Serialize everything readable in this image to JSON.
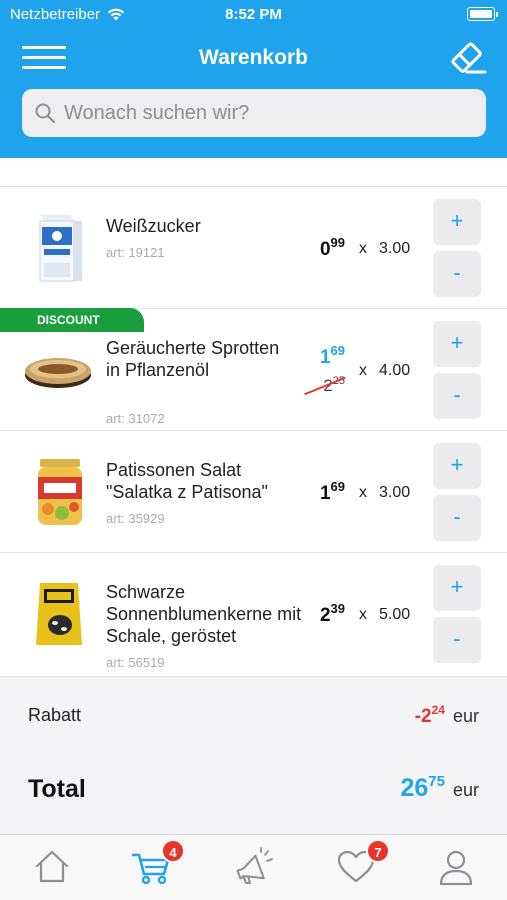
{
  "status": {
    "carrier": "Netzbetreiber",
    "time": "8:52 PM"
  },
  "header": {
    "title": "Warenkorb"
  },
  "search": {
    "placeholder": "Wonach suchen wir?"
  },
  "items": [
    {
      "name": "Weißzucker",
      "art": "art: 19121",
      "price_int": "0",
      "price_dec": "99",
      "qty_x": "x",
      "qty": "3.00",
      "plus": "+",
      "minus": "-"
    },
    {
      "badge": "DISCOUNT",
      "name": "Geräucherte Sprotten in Pflanzenöl",
      "art": "art: 31072",
      "price_int": "1",
      "price_dec": "69",
      "old_int": "2",
      "old_dec": "25",
      "qty_x": "x",
      "qty": "4.00",
      "plus": "+",
      "minus": "-"
    },
    {
      "name": "Patissonen Salat \"Salatka z Patisona\"",
      "art": "art: 35929",
      "price_int": "1",
      "price_dec": "69",
      "qty_x": "x",
      "qty": "3.00",
      "plus": "+",
      "minus": "-"
    },
    {
      "name": "Schwarze Sonnenblumenkerne mit Schale, geröstet",
      "art": "art: 56519",
      "price_int": "2",
      "price_dec": "39",
      "qty_x": "x",
      "qty": "5.00",
      "plus": "+",
      "minus": "-"
    }
  ],
  "summary": {
    "rabatt_label": "Rabatt",
    "rabatt_int": "-2",
    "rabatt_dec": "24",
    "currency": "eur",
    "total_label": "Total",
    "total_int": "26",
    "total_dec": "75"
  },
  "tabbar": {
    "cart_badge": "4",
    "favorites_badge": "7"
  },
  "colors": {
    "accent": "#1EA3EC",
    "discount": "#1B9E3E",
    "danger": "#E8352B"
  },
  "icons": [
    "wifi-icon",
    "battery-icon",
    "menu-icon",
    "eraser-icon",
    "search-icon",
    "home-icon",
    "cart-icon",
    "megaphone-icon",
    "heart-icon",
    "profile-icon"
  ]
}
